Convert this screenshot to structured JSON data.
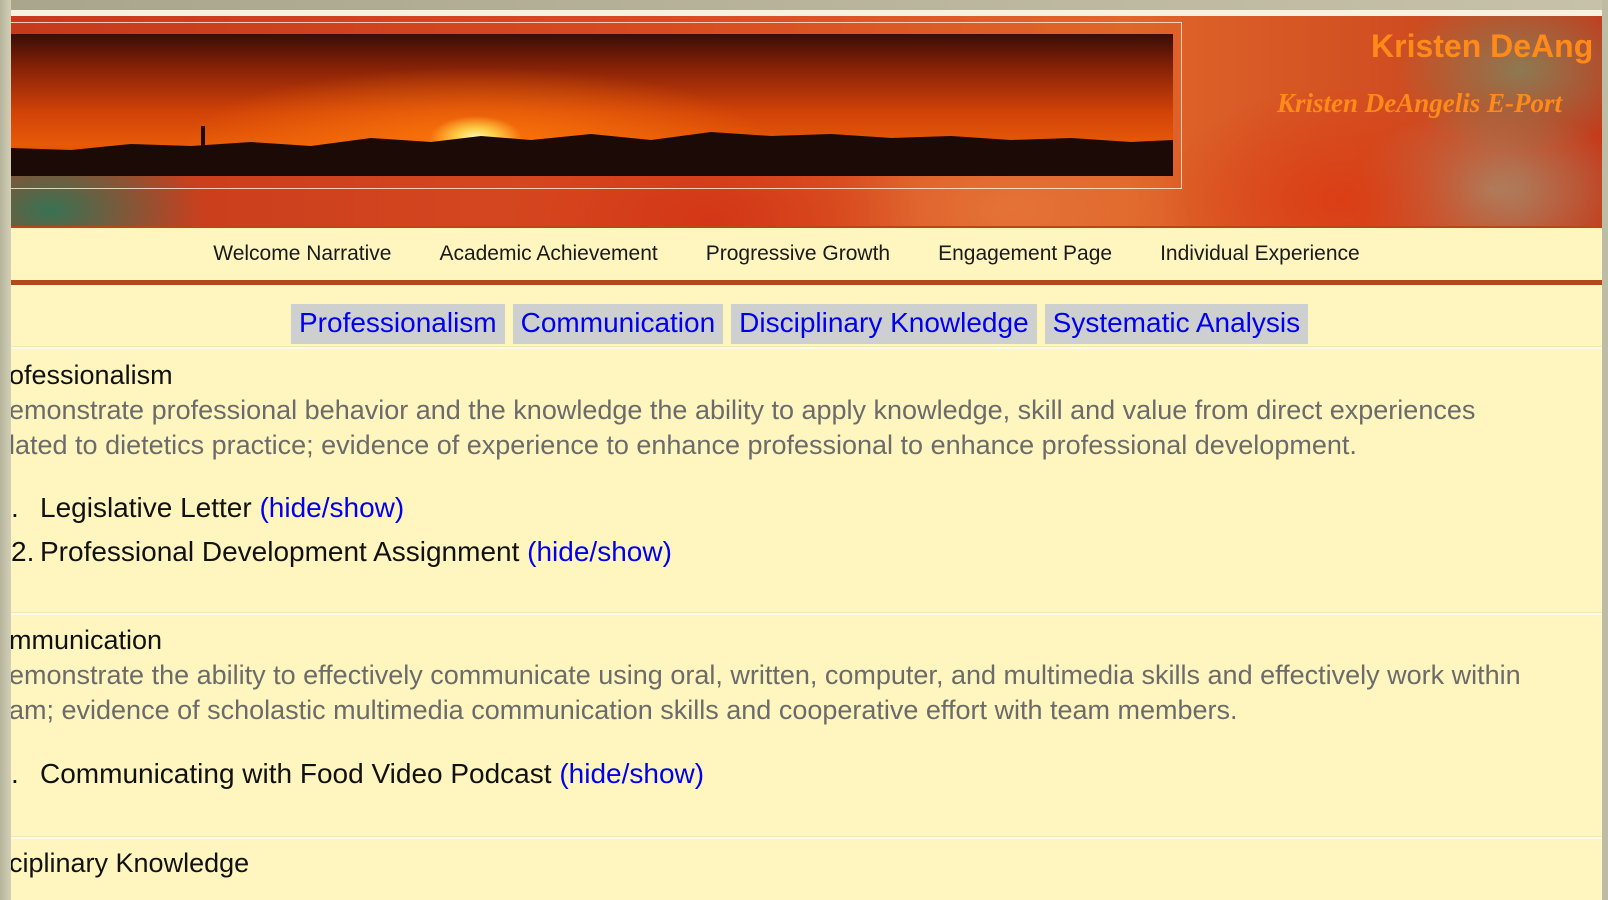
{
  "header": {
    "title": "Kristen DeAng",
    "subtitle": "Kristen DeAngelis E-Port"
  },
  "nav": {
    "items": [
      {
        "label": "Welcome Narrative"
      },
      {
        "label": "Academic Achievement"
      },
      {
        "label": "Progressive Growth"
      },
      {
        "label": "Engagement Page"
      },
      {
        "label": "Individual Experience"
      }
    ]
  },
  "tabs": [
    {
      "label": "Professionalism"
    },
    {
      "label": "Communication"
    },
    {
      "label": "Disciplinary Knowledge"
    },
    {
      "label": "Systematic Analysis"
    }
  ],
  "sections": [
    {
      "title": "ofessionalism",
      "desc_line1": "emonstrate professional behavior and the knowledge the ability to apply knowledge, skill and value from direct experiences",
      "desc_line2": "lated to dietetics practice; evidence of experience to enhance professional to enhance professional development.",
      "items": [
        {
          "num": ".",
          "label": "Legislative Letter",
          "toggle": "(hide/show)"
        },
        {
          "num": "2.",
          "label": "Professional Development Assignment",
          "toggle": "(hide/show)"
        }
      ]
    },
    {
      "title": "mmunication",
      "desc_line1": "emonstrate the ability to effectively communicate using oral, written, computer, and multimedia skills and effectively work within",
      "desc_line2": "am; evidence of scholastic multimedia communication skills and cooperative effort with team members.",
      "items": [
        {
          "num": ".",
          "label": "Communicating with Food Video Podcast",
          "toggle": "(hide/show)"
        }
      ]
    },
    {
      "title": "ciplinary Knowledge"
    }
  ],
  "colors": {
    "page_bg": "#fff5bf",
    "link": "#0000ee",
    "title_orange": "#ff8a1a",
    "nav_rule": "#b24a18"
  }
}
